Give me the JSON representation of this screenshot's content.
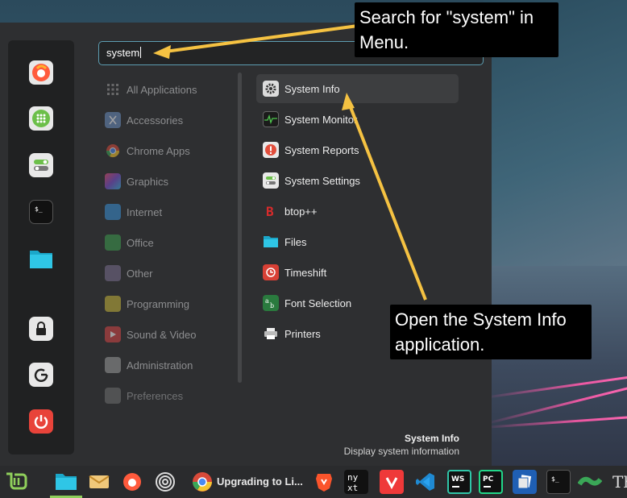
{
  "search": {
    "value": "system"
  },
  "categories": [
    {
      "label": "All Applications",
      "icon": "grid-icon"
    },
    {
      "label": "Accessories",
      "icon": "scissors-icon"
    },
    {
      "label": "Chrome Apps",
      "icon": "chrome-icon"
    },
    {
      "label": "Graphics",
      "icon": "graphics-icon"
    },
    {
      "label": "Internet",
      "icon": "cloud-icon"
    },
    {
      "label": "Office",
      "icon": "office-icon"
    },
    {
      "label": "Other",
      "icon": "apps-icon"
    },
    {
      "label": "Programming",
      "icon": "programming-icon"
    },
    {
      "label": "Sound & Video",
      "icon": "play-icon"
    },
    {
      "label": "Administration",
      "icon": "admin-icon"
    },
    {
      "label": "Preferences",
      "icon": "preferences-icon"
    }
  ],
  "apps": [
    {
      "label": "System Info",
      "icon": "gear-icon",
      "selected": true
    },
    {
      "label": "System Monitor",
      "icon": "monitor-icon"
    },
    {
      "label": "System Reports",
      "icon": "alert-icon"
    },
    {
      "label": "System Settings",
      "icon": "toggle-icon"
    },
    {
      "label": "btop++",
      "icon": "btop-icon"
    },
    {
      "label": "Files",
      "icon": "folder-icon"
    },
    {
      "label": "Timeshift",
      "icon": "timeshift-icon"
    },
    {
      "label": "Font Selection",
      "icon": "font-icon"
    },
    {
      "label": "Printers",
      "icon": "printer-icon"
    }
  ],
  "description": {
    "title": "System Info",
    "text": "Display system information"
  },
  "callouts": {
    "search": "Search for \"system\" in Menu.",
    "open": "Open the System Info application."
  },
  "taskbar": {
    "active_window_title": "Upgrading to Li..."
  },
  "colors": {
    "accent": "#8fcf5b",
    "search_border": "#5c9cb0",
    "callout_arrow": "#f5c242"
  }
}
